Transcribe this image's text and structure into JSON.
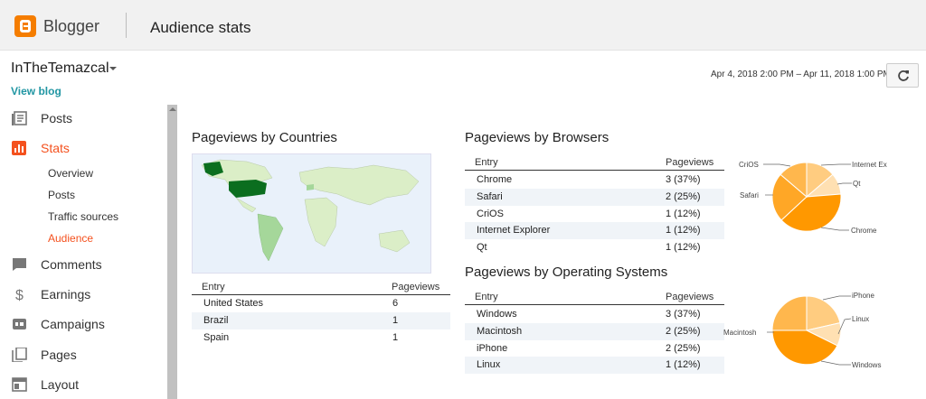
{
  "header": {
    "brand": "Blogger",
    "title": "Audience stats"
  },
  "blog": {
    "name": "InTheTemazcal",
    "view_blog": "View blog"
  },
  "date_range": "Apr 4, 2018 2:00 PM – Apr 11, 2018 1:00 PM",
  "sidebar": {
    "items": [
      {
        "label": "Posts",
        "icon": "posts-icon"
      },
      {
        "label": "Stats",
        "icon": "stats-icon"
      },
      {
        "label": "Comments",
        "icon": "comments-icon"
      },
      {
        "label": "Earnings",
        "icon": "dollar-icon"
      },
      {
        "label": "Campaigns",
        "icon": "campaigns-icon"
      },
      {
        "label": "Pages",
        "icon": "pages-icon"
      },
      {
        "label": "Layout",
        "icon": "layout-icon"
      }
    ],
    "stats_sub": [
      "Overview",
      "Posts",
      "Traffic sources",
      "Audience"
    ],
    "active_color": "#f4511e"
  },
  "countries": {
    "title": "Pageviews by Countries",
    "columns": [
      "Entry",
      "Pageviews"
    ],
    "rows": [
      [
        "United States",
        "6"
      ],
      [
        "Brazil",
        "1"
      ],
      [
        "Spain",
        "1"
      ]
    ]
  },
  "browsers": {
    "title": "Pageviews by Browsers",
    "columns": [
      "Entry",
      "Pageviews"
    ],
    "rows": [
      [
        "Chrome",
        "3 (37%)"
      ],
      [
        "Safari",
        "2 (25%)"
      ],
      [
        "CriOS",
        "1 (12%)"
      ],
      [
        "Internet Explorer",
        "1 (12%)"
      ],
      [
        "Qt",
        "1 (12%)"
      ]
    ],
    "pie_labels": [
      "CriOS",
      "Internet Ex",
      "Qt",
      "Safari",
      "Chrome"
    ]
  },
  "os": {
    "title": "Pageviews by Operating Systems",
    "columns": [
      "Entry",
      "Pageviews"
    ],
    "rows": [
      [
        "Windows",
        "3 (37%)"
      ],
      [
        "Macintosh",
        "2 (25%)"
      ],
      [
        "iPhone",
        "2 (25%)"
      ],
      [
        "Linux",
        "1 (12%)"
      ]
    ],
    "pie_labels": [
      "iPhone",
      "Linux",
      "Macintosh",
      "Windows"
    ]
  }
}
